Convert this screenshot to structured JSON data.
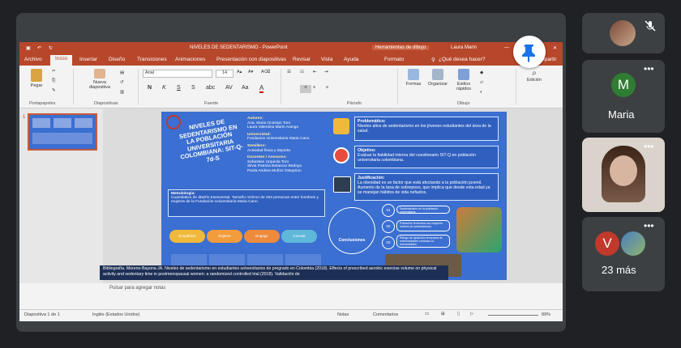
{
  "window": {
    "title": "NIVELES DE SEDENTARISMO - PowerPoint",
    "tools_tab": "Herramientas de dibujo",
    "user": "Laura Marin"
  },
  "menu": {
    "items": [
      "Archivo",
      "Inicio",
      "Insertar",
      "Diseño",
      "Transiciones",
      "Animaciones",
      "Presentación con diapositivas",
      "Revisar",
      "Vista",
      "Ayuda",
      "Formato"
    ],
    "search": "¿Qué desea hacer?",
    "share": "Compartir"
  },
  "ribbon": {
    "paste": "Pegar",
    "clipboard": "Portapapeles",
    "new_slide": "Nueva diapositiva",
    "slides": "Diapositivas",
    "font_name": "Arial",
    "font_size": "14",
    "font_group": "Fuente",
    "paragraph": "Párrafo",
    "shapes": "Formas",
    "arrange": "Organizar",
    "quick_styles": "Estilos rápidos",
    "drawing": "Dibujo",
    "editing": "Edición",
    "bold": "N",
    "italic": "K",
    "underline": "S",
    "strike": "S"
  },
  "thumbnail": {
    "number": "1"
  },
  "slide": {
    "title": "NIVELES DE SEDENTARISMO EN LA POBLACIÓN UNIVERSITARIA COLOMBIANA: SIT-Q-7d-S",
    "authors_h": "Autores:",
    "authors": "Ana. Maria Ocampo Toro\nLaura Valentina Marin Arango",
    "univ_h": "Universidad:",
    "univ": "Fundacion Universitaria Maria Cano",
    "line_h": "Semillero:",
    "line": "Actividad fisica y deporte.",
    "advisors_h": "Docentes / Asesores:",
    "advisors": "Sebastian Urquiola Toro\nSilvia Patricia Betancur Bedoya\nPaola Andrea Muñoz Ostuprion",
    "method_h": "Metodología:",
    "method": "Cuantitativo de diseño transversal. Tamaño mínimo de 204 personas entre hombres y mujeres de la Fundación Universitaria Maria Cano.",
    "problem_h": "Problemático:",
    "problem": "Niveles altos de sedentarismo en los jóvenes estudiantes del área de la salud.",
    "objective_h": "Objetivo:",
    "objective": "Evaluar la fiabilidad interna del cuestionario SIT-Q en población universitaria colombiana.",
    "justif_h": "Justificación:",
    "justif": "La obesidad es un factor que está afectando a la población juvenil. Aumento de la tasa de sobrepeso, que implica que desde esta edad ya se manejan hábitos de vida nefastos.",
    "steps": [
      "Empathize",
      "Explore",
      "Engage",
      "Consult"
    ],
    "conclusions": "Conclusiones",
    "concl_items": [
      "01",
      "02",
      "03"
    ],
    "concl_texts": [
      "Sedentarismo en la población universitaria",
      "Población femenina con mayores índices de sedentarismo",
      "Riesgo de aparición temprana de enfermedades crónicas no transmisibles"
    ]
  },
  "notes_placeholder": "Pulsar para agregar notas",
  "bibliography": "Bibliografía. Moreno-Bayona JA. Niveles de sedentarismo en estudiantes universitarios de pregrado en Colombia (2018). Effects of prescribed aerobic exercise volume on physical activity and sedentary time in postmenopausal women: a randomized controlled trial (2018). Validación de",
  "status": {
    "slide": "Diapositiva 1 de 1",
    "language": "Inglés (Estados Unidos)",
    "notes": "Notas",
    "comments": "Comentarios",
    "zoom": "89%"
  },
  "participants": [
    {
      "name": "",
      "muted": true
    },
    {
      "name": "Maria",
      "initial": "M",
      "color": "#2e7d32"
    },
    {
      "name": "",
      "camera": true
    },
    {
      "name": "23 más",
      "initial": "V",
      "color": "#c0392b"
    }
  ]
}
